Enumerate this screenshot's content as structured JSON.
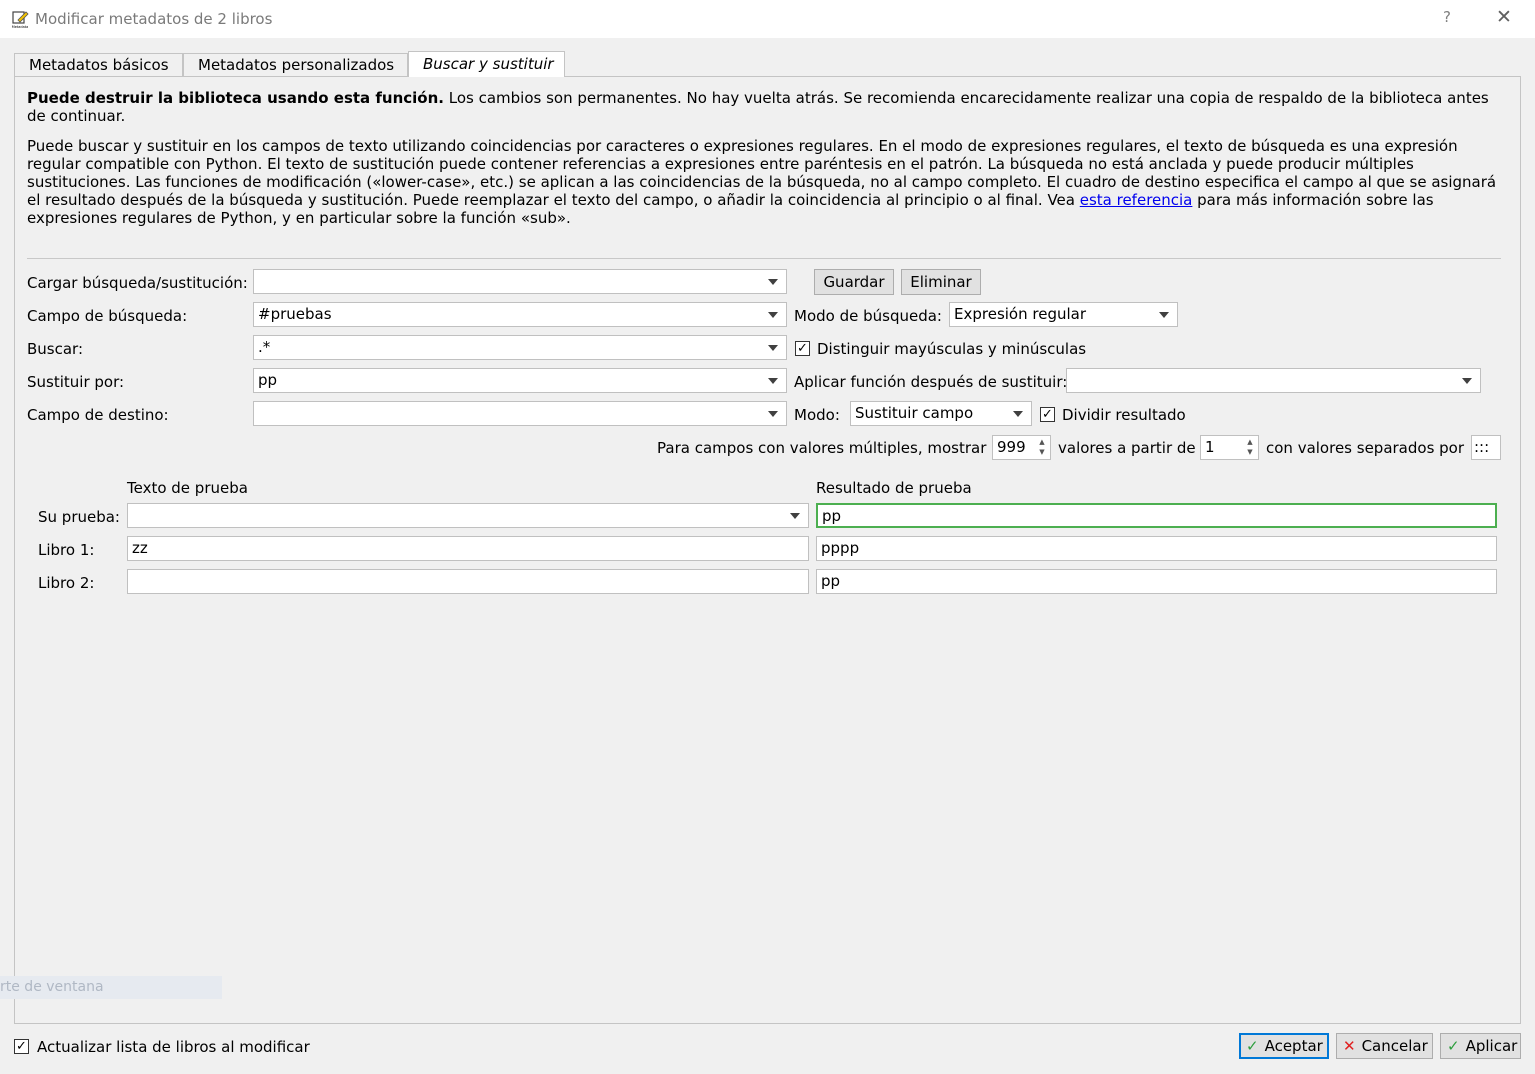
{
  "window": {
    "title": "Modificar metadatos de 2 libros",
    "help_label": "?",
    "close_label": "✕",
    "icon_label": "Metadata"
  },
  "tabs": [
    {
      "label": "Metadatos básicos",
      "active": false
    },
    {
      "label": "Metadatos personalizados",
      "active": false
    },
    {
      "label": "Buscar y sustituir",
      "active": true
    }
  ],
  "intro": {
    "warning_bold": "Puede destruir la biblioteca usando esta función.",
    "warning_rest": " Los cambios son permanentes. No hay vuelta atrás. Se recomienda encarecidamente realizar una copia de respaldo de la biblioteca antes de continuar.",
    "description_part1": "Puede buscar y sustituir en los campos de texto utilizando coincidencias por caracteres o expresiones regulares. En el modo de expresiones regulares, el texto de búsqueda es una expresión regular compatible con Python. El texto de sustitución puede contener referencias a expresiones entre paréntesis en el patrón. La búsqueda no está anclada y puede producir múltiples sustituciones. Las funciones de modificación («lower-case», etc.) se aplican a las coincidencias de la búsqueda, no al campo completo. El cuadro de destino especifica el campo al que se asignará el resultado después de la búsqueda y sustitución. Puede reemplazar el texto del campo, o añadir la coincidencia al principio o al final. Vea ",
    "link_text": "esta referencia",
    "description_part2": " para más información sobre las expresiones regulares de Python, y en particular sobre la función «sub»."
  },
  "form": {
    "load_label": "Cargar búsqueda/sustitución:",
    "load_value": "",
    "save_button": "Guardar",
    "delete_button": "Eliminar",
    "search_field_label": "Campo de búsqueda:",
    "search_field_value": "#pruebas",
    "search_mode_label": "Modo de búsqueda:",
    "search_mode_value": "Expresión regular",
    "find_label": "Buscar:",
    "find_value": ".*",
    "case_sensitive_label": "Distinguir mayúsculas y minúsculas",
    "case_sensitive_checked": true,
    "replace_label": "Sustituir por:",
    "replace_value": "pp",
    "apply_function_label": "Aplicar función después de sustituir:",
    "apply_function_value": "",
    "dest_field_label": "Campo de destino:",
    "dest_field_value": "",
    "mode_label": "Modo:",
    "mode_value": "Sustituir campo",
    "split_result_label": "Dividir resultado",
    "split_result_checked": true,
    "multi_prefix": "Para campos con valores múltiples, mostrar",
    "multi_count": "999",
    "multi_mid": "valores a partir de",
    "multi_start": "1",
    "multi_suffix": "con valores separados por",
    "multi_separator": ":::"
  },
  "test": {
    "text_header": "Texto de prueba",
    "result_header": "Resultado de prueba",
    "rows": [
      {
        "label": "Su prueba:",
        "text": "",
        "result": "pp"
      },
      {
        "label": "Libro 1:",
        "text": "zz",
        "result": "pppp"
      },
      {
        "label": "Libro 2:",
        "text": "",
        "result": "pp"
      }
    ]
  },
  "ghost_text": "rte de ventana",
  "footer": {
    "refresh_label": "Actualizar lista de libros al modificar",
    "refresh_checked": true,
    "ok_button": "Aceptar",
    "cancel_button": "Cancelar",
    "apply_button": "Aplicar"
  },
  "colors": {
    "accent": "#0078d7",
    "focus_border": "#4caf50",
    "link": "#0000ee"
  }
}
